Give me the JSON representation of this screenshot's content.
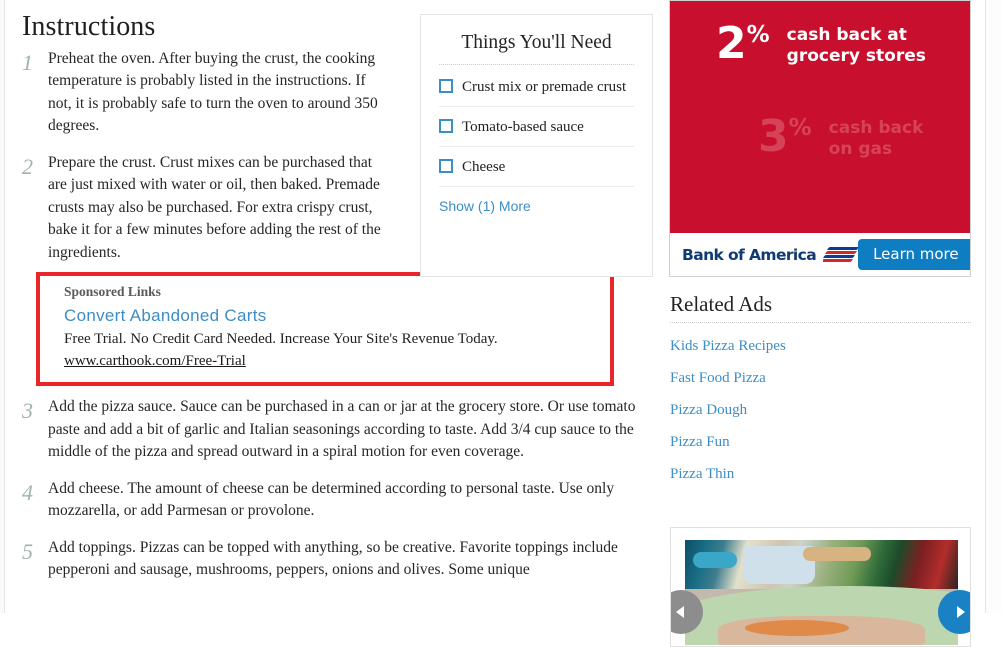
{
  "colors": {
    "accent_blue": "#3d8dc6",
    "step_number": "#9fb3b1",
    "sponsored_border": "#e8262a",
    "boa_red": "#c8102e",
    "boa_navy": "#103a73",
    "button_blue": "#0f7dc2"
  },
  "instructions": {
    "title": "Instructions",
    "steps": [
      {
        "number": "1",
        "text": "Preheat the oven. After buying the crust, the cooking temperature is probably listed in the instructions. If not, it is probably safe to turn the oven to around 350 degrees."
      },
      {
        "number": "2",
        "text": "Prepare the crust. Crust mixes can be purchased that are just mixed with water or oil, then baked. Premade crusts may also be purchased. For extra crispy crust, bake it for a few minutes before adding the rest of the ingredients."
      },
      {
        "number": "3",
        "text": "Add the pizza sauce. Sauce can be purchased in a can or jar at the grocery store. Or use tomato paste and add a bit of garlic and Italian seasonings according to taste. Add 3/4 cup sauce to the middle of the pizza and spread outward in a spiral motion for even coverage."
      },
      {
        "number": "4",
        "text": "Add cheese. The amount of cheese can be determined according to personal taste. Use only mozzarella, or add Parmesan or provolone."
      },
      {
        "number": "5",
        "text": "Add toppings. Pizzas can be topped with anything, so be creative. Favorite toppings include pepperoni and sausage, mushrooms, peppers, onions and olives. Some unique"
      }
    ]
  },
  "sponsored": {
    "label": "Sponsored Links",
    "title": "Convert Abandoned Carts",
    "description": "Free Trial. No Credit Card Needed. Increase Your Site's Revenue Today.",
    "url": "www.carthook.com/Free-Trial"
  },
  "things_you_need": {
    "title": "Things You'll Need",
    "items": [
      "Crust mix or premade crust",
      "Tomato-based sauce",
      "Cheese"
    ],
    "show_more_label": "Show (1) More"
  },
  "boa_ad": {
    "primary": {
      "number": "2",
      "percent": "%",
      "line1": "cash back at",
      "line2": "grocery stores"
    },
    "secondary": {
      "number": "3",
      "percent": "%",
      "line1": "cash back",
      "line2": "on gas"
    },
    "brand": "Bank of America",
    "cta_label": "Learn more"
  },
  "related_ads": {
    "title": "Related Ads",
    "links": [
      "Kids Pizza Recipes",
      "Fast Food Pizza",
      "Pizza Dough",
      "Pizza Fun",
      "Pizza Thin"
    ]
  },
  "carousel": {
    "prev_label": "◀",
    "next_label": "▶"
  }
}
